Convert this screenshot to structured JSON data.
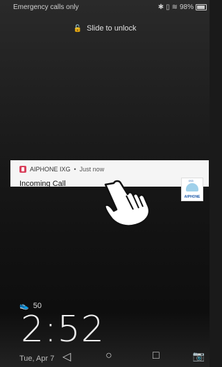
{
  "status": {
    "carrier": "Emergency calls only",
    "battery": "98%"
  },
  "lockscreen": {
    "slide_hint": "Slide to unlock",
    "steps": "50",
    "time": "2:52",
    "date": "Tue, Apr 7"
  },
  "notification": {
    "app": "AIPHONE IXG",
    "time": "Just now",
    "title": "Incoming Call",
    "thumb_brand": "AIPHONE",
    "thumb_badge": "IXG"
  },
  "icons": {
    "lock": "lock-icon",
    "steps": "shoe-icon",
    "back": "back-icon",
    "home": "home-icon",
    "recents": "recents-icon",
    "camera": "camera-icon"
  },
  "colors": {
    "app_icon": "#d9415c",
    "notification_bg": "#f5f5f5",
    "brand_blue": "#1b58a8"
  }
}
